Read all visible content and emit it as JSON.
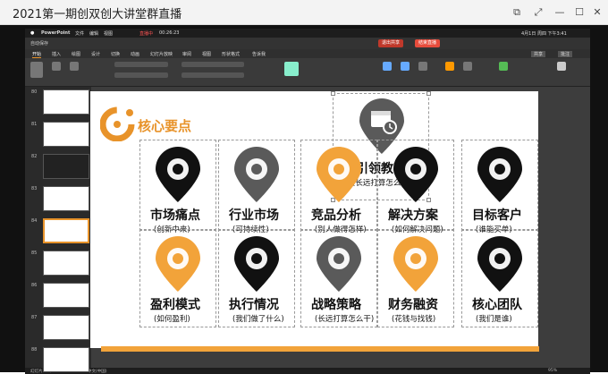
{
  "window": {
    "title": "2021第一期创双创大讲堂群直播"
  },
  "menubar": {
    "app": "PowerPoint",
    "items": [
      "文件",
      "编辑",
      "视图"
    ],
    "right": "4月1日 周四 下午3:41"
  },
  "qbar": {
    "auto_save": "自动保存",
    "live": "直播中",
    "time": "00:26:23",
    "live_btn": "退出共享",
    "end_btn": "结束直播"
  },
  "tabs": [
    "开始",
    "插入",
    "绘图",
    "设计",
    "切换",
    "动画",
    "幻灯片放映",
    "审阅",
    "视图",
    "形状格式",
    "告诉我"
  ],
  "share": {
    "label": "共享",
    "comment": "批注"
  },
  "thumbs": [
    {
      "num": "80"
    },
    {
      "num": "81"
    },
    {
      "num": "82"
    },
    {
      "num": "83"
    },
    {
      "num": "84"
    },
    {
      "num": "85"
    },
    {
      "num": "86"
    },
    {
      "num": "87"
    },
    {
      "num": "88"
    }
  ],
  "status": {
    "slide": "幻灯片 84 / 117",
    "lang": "中文(中国)",
    "zoom": "95%"
  },
  "slide": {
    "title": "核心要点",
    "center": {
      "label": "引领教育",
      "sub": "(长远打算怎么干)"
    },
    "items": [
      {
        "label": "市场痛点",
        "sub": "(创新中来)",
        "color": "#111111",
        "icon": "shield-icon"
      },
      {
        "label": "行业市场",
        "sub": "(可持续性)",
        "color": "#5a5a5a",
        "icon": "globe-icon"
      },
      {
        "label": "竞品分析",
        "sub": "(别人做得怎样)",
        "color": "#f2a33a",
        "icon": "people-board-icon"
      },
      {
        "label": "解决方案",
        "sub": "(如何解决问题)",
        "color": "#111111",
        "icon": "head-gear-icon"
      },
      {
        "label": "目标客户",
        "sub": "(谁能买单)",
        "color": "#111111",
        "icon": "books-icon"
      },
      {
        "label": "盈利模式",
        "sub": "(如何盈利)",
        "color": "#f2a33a",
        "icon": "tools-icon"
      },
      {
        "label": "执行情况",
        "sub": "(我们做了什么)",
        "color": "#111111",
        "icon": "presentation-icon"
      },
      {
        "label": "战略策略",
        "sub": "(长远打算怎么干)",
        "color": "#5a5a5a",
        "icon": "calendar-clock-icon"
      },
      {
        "label": "财务融资",
        "sub": "(花钱与找钱)",
        "color": "#f2a33a",
        "icon": "coins-icon"
      },
      {
        "label": "核心团队",
        "sub": "(我们是谁)",
        "color": "#111111",
        "icon": "team-icon"
      }
    ]
  }
}
